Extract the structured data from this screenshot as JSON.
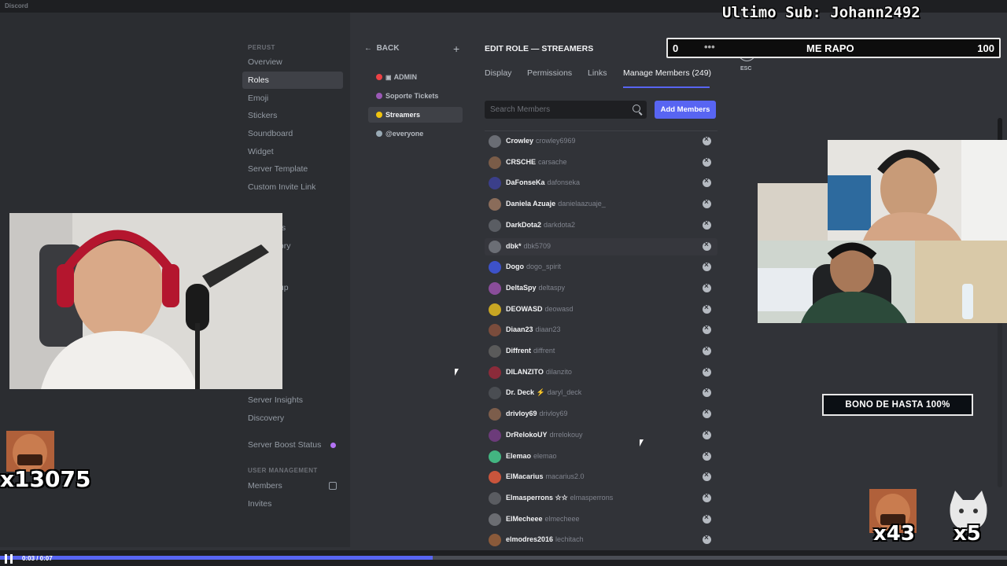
{
  "window": {
    "app_name": "Discord"
  },
  "overlay": {
    "last_sub": "Ultimo Sub: Johann2492",
    "goal": {
      "start": "0",
      "dots": "•••",
      "name": "ME RAPO",
      "end": "100",
      "progress": 0
    },
    "bono_banner": "BONO DE HASTA 100%",
    "emote_counts": [
      {
        "label": "x13075"
      },
      {
        "label": "x43"
      },
      {
        "label": "x5"
      }
    ]
  },
  "settings_sidebar": {
    "section_top": "PERUST",
    "items_top": [
      "Overview",
      "Roles",
      "Emoji",
      "Stickers",
      "Soundboard",
      "Widget",
      "Server Template",
      "Custom Invite Link"
    ],
    "partial_1": "ns",
    "partial_2": "tory",
    "partial_3": "tup",
    "items_mid": [
      "Server Insights",
      "Discovery"
    ],
    "boost": "Server Boost Status",
    "section_user": "USER MANAGEMENT",
    "items_user": [
      "Members",
      "Invites"
    ]
  },
  "roles_pane": {
    "back_label": "BACK",
    "add_label": "+",
    "roles": [
      {
        "name": "ADMIN",
        "color": "#ed4245",
        "lock": "🔒"
      },
      {
        "name": "Soporte Tickets",
        "color": "#9b59b6"
      },
      {
        "name": "Streamers",
        "color": "#f1c40f"
      },
      {
        "name": "@everyone",
        "color": "#99aab5"
      }
    ]
  },
  "editor": {
    "title": "EDIT ROLE — STREAMERS",
    "tabs": [
      "Display",
      "Permissions",
      "Links",
      "Manage Members (249)"
    ],
    "search_placeholder": "Search Members",
    "add_button": "Add Members",
    "close_label": "ESC",
    "members": [
      {
        "display": "Crowley",
        "user": "crowley6969"
      },
      {
        "display": "CRSCHE",
        "user": "carsache"
      },
      {
        "display": "DaFonseKa",
        "user": "dafonseka"
      },
      {
        "display": "Daniela Azuaje",
        "user": "danielaazuaje_"
      },
      {
        "display": "DarkDota2",
        "user": "darkdota2"
      },
      {
        "display": "dbk*",
        "user": "dbk5709"
      },
      {
        "display": "Dogo",
        "user": "dogo_spirit"
      },
      {
        "display": "DeltaSpy",
        "user": "deltaspy"
      },
      {
        "display": "DEOWASD",
        "user": "deowasd"
      },
      {
        "display": "Diaan23",
        "user": "diaan23"
      },
      {
        "display": "Diffrent",
        "user": "diffrent"
      },
      {
        "display": "DILANZITO",
        "user": "dilanzito"
      },
      {
        "display": "Dr. Deck ⚡",
        "user": "daryl_deck"
      },
      {
        "display": "drivloy69",
        "user": "drivloy69"
      },
      {
        "display": "DrRelokoUY",
        "user": "drrelokouy"
      },
      {
        "display": "Elemao",
        "user": "elemao"
      },
      {
        "display": "ElMacarius",
        "user": "macarius2.0"
      },
      {
        "display": "Elmasperrons ☆☆",
        "user": "elmasperrons"
      },
      {
        "display": "ElMecheee",
        "user": "elmecheee"
      },
      {
        "display": "elmodres2016",
        "user": "lechitach"
      }
    ]
  },
  "player": {
    "time": "0:03 / 0:07",
    "progress": 0.43
  },
  "colors": {
    "accent": "#5865f2",
    "bg": "#313338",
    "sidebar": "#2b2d31"
  }
}
